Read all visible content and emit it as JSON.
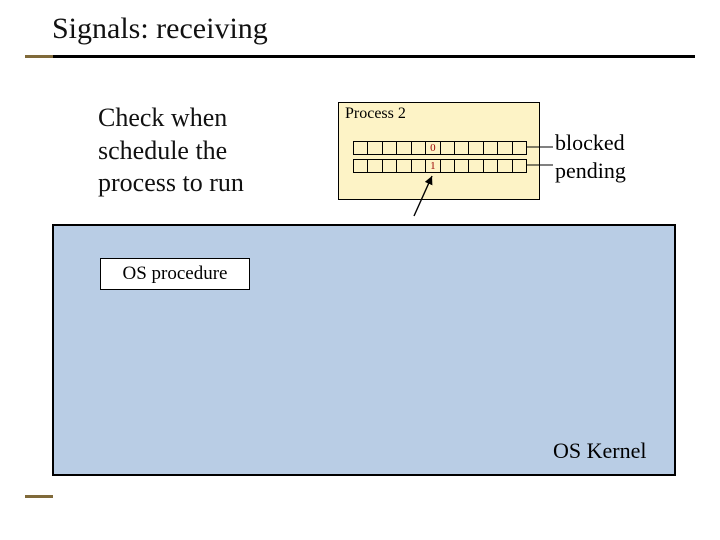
{
  "title": "Signals: receiving",
  "check_text_line1": "Check when",
  "check_text_line2": "schedule the",
  "check_text_line3": "process to run",
  "process2": {
    "title": "Process 2",
    "row_blocked": [
      "",
      "",
      "",
      "",
      "",
      "0",
      "",
      "",
      "",
      "",
      "",
      ""
    ],
    "row_pending": [
      "",
      "",
      "",
      "",
      "",
      "1",
      "",
      "",
      "",
      "",
      "",
      ""
    ]
  },
  "labels": {
    "blocked": "blocked",
    "pending": "pending",
    "os_procedure": "OS procedure",
    "os_kernel": "OS Kernel"
  }
}
